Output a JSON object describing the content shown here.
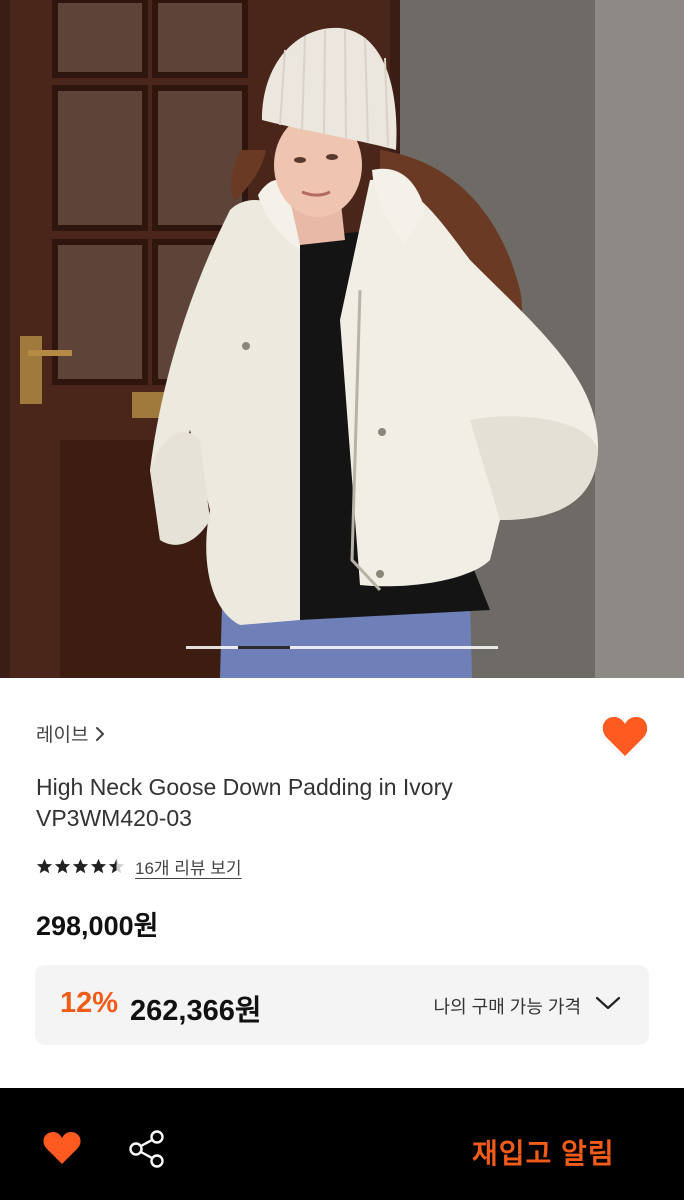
{
  "product": {
    "image_alt": "Model wearing ivory high neck goose down padding jacket",
    "gallery": {
      "count": 6,
      "active_index": 1
    },
    "brand": "레이브",
    "title_line1": "High Neck Goose Down Padding in Ivory",
    "title_line2": "VP3WM420-03",
    "rating": 4.5,
    "review_link": "16개 리뷰 보기",
    "price": "298,000원",
    "discount": {
      "percent": "12%",
      "price": "262,366원",
      "label": "나의 구매 가능 가격"
    }
  },
  "bottom_bar": {
    "restock_label": "재입고 알림"
  },
  "colors": {
    "accent": "#f25c19",
    "heart": "#ff5a1f",
    "bar_bg": "#000000",
    "deal_bg": "#f4f4f4"
  },
  "icons": {
    "brand_chevron": "chevron-right-icon",
    "wishlist": "heart-icon",
    "rating_star": "star-icon",
    "deal_chevron": "chevron-down-icon",
    "share": "share-icon"
  }
}
